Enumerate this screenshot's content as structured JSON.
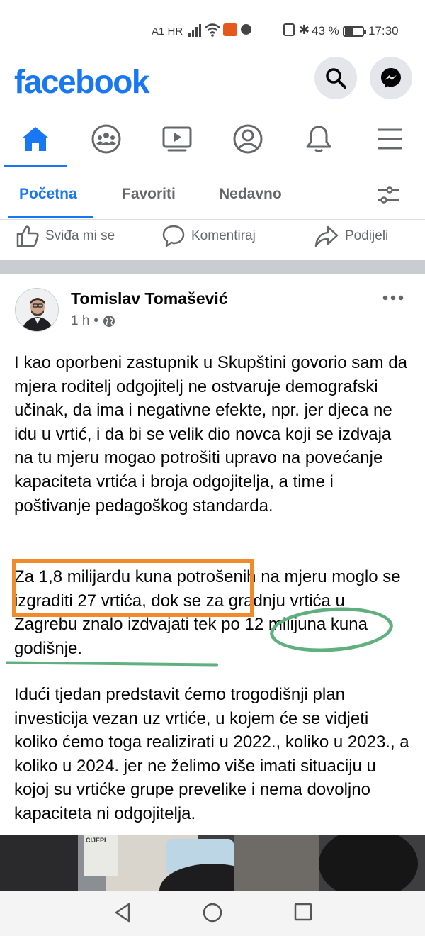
{
  "status_bar": {
    "carrier": "A1 HR",
    "battery_text": "43 %",
    "battery_level": 0.43,
    "time": "17:30"
  },
  "header": {
    "logo_text": "facebook",
    "brand_color": "#1877f2"
  },
  "top_nav": {
    "items": [
      {
        "icon": "home-icon",
        "active": true
      },
      {
        "icon": "groups-icon",
        "active": false
      },
      {
        "icon": "watch-icon",
        "active": false
      },
      {
        "icon": "profile-icon",
        "active": false
      },
      {
        "icon": "bell-icon",
        "active": false
      },
      {
        "icon": "menu-icon",
        "active": false
      }
    ]
  },
  "feed_tabs": {
    "items": [
      "Početna",
      "Favoriti",
      "Nedavno"
    ],
    "active": "Početna"
  },
  "post_actions": {
    "like": "Sviđa mi se",
    "comment": "Komentiraj",
    "share": "Podijeli"
  },
  "post": {
    "author": "Tomislav Tomašević",
    "time": "1 h",
    "separator": "•",
    "paragraphs": [
      "I kao oporbeni zastupnik u Skupštini govorio sam da mjera roditelj odgojitelj ne ostvaruje demografski učinak, da ima i negativne efekte, npr. jer djeca ne idu u vrtić, i da bi se velik dio novca koji se izdvaja na tu mjeru mogao potrošiti upravo na povećanje kapaciteta vrtića i broja odgojitelja, a time i poštivanje pedagoškog standarda.",
      "Za 1,8 milijardu kuna potrošenih na mjeru moglo se izgraditi 27 vrtića, dok se za gradnju vrtića u Zagrebu znalo izdvajati tek po 12 milijuna kuna godišnje.",
      "Idući tjedan predstavit ćemo trogodišnji plan investicija vezan uz vrtiće, u kojem će se vidjeti koliko ćemo toga realizirati u 2022., koliko u 2023., a koliko u 2024. jer ne želimo više imati situaciju u kojoj su vrtićke grupe prevelike i nema dovoljno kapaciteta ni odgojitelja."
    ],
    "image_sign_text": "CIJEPI"
  },
  "annotation_colors": {
    "orange": "#f08a2a",
    "green": "#5fb07e"
  }
}
